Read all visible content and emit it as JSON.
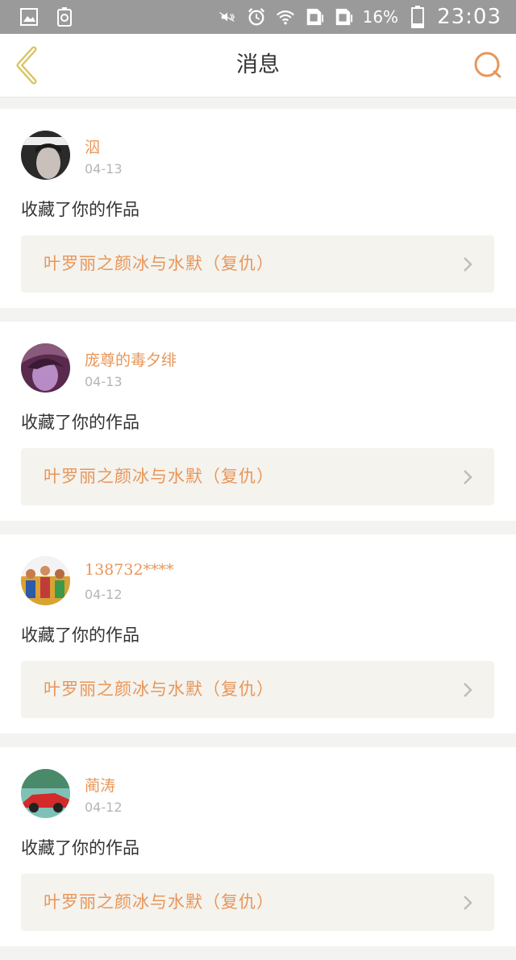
{
  "status_bar": {
    "battery": "16%",
    "time": "23:03"
  },
  "nav": {
    "title": "消息"
  },
  "feed": [
    {
      "username": "泅",
      "date": "04-13",
      "action": "收藏了你的作品",
      "work_title": "叶罗丽之颜冰与水默（复仇）"
    },
    {
      "username": "庞尊的毒夕绯",
      "date": "04-13",
      "action": "收藏了你的作品",
      "work_title": "叶罗丽之颜冰与水默（复仇）"
    },
    {
      "username": "138732****",
      "date": "04-12",
      "action": "收藏了你的作品",
      "work_title": "叶罗丽之颜冰与水默（复仇）"
    },
    {
      "username": "蔺涛",
      "date": "04-12",
      "action": "收藏了你的作品",
      "work_title": "叶罗丽之颜冰与水默（复仇）"
    }
  ],
  "colors": {
    "accent": "#e8965a",
    "back_arrow": "#d9c25a",
    "status_bar": "#9a9a9a"
  }
}
